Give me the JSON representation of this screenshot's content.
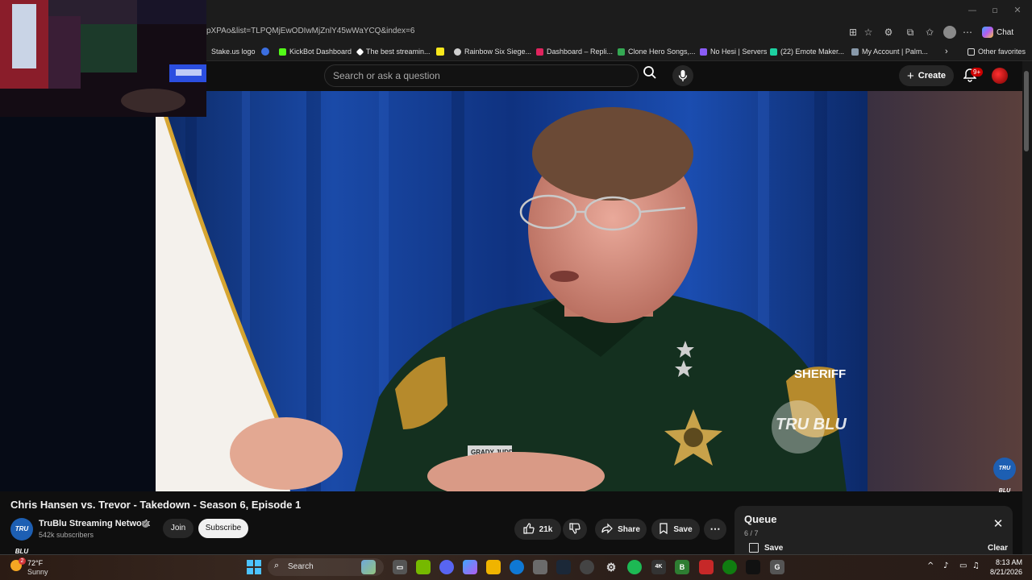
{
  "browser": {
    "url": "pXPAo&list=TLPQMjEwODIwMjZnlY45wWaYCQ&index=6",
    "copilot_label": "Chat",
    "bookmarks": [
      {
        "label": "Stake.us logo",
        "color": "#1a2c38"
      },
      {
        "label": "",
        "color": "#3b6ee0"
      },
      {
        "label": "KickBot Dashboard",
        "color": "#53fc18"
      },
      {
        "label": "The best streamin...",
        "color": "#ffffff"
      },
      {
        "label": "",
        "color": "#f8e71c"
      },
      {
        "label": "Rainbow Six Siege...",
        "color": "#cfcfcf"
      },
      {
        "label": "Dashboard – Repli...",
        "color": "#e0245e"
      },
      {
        "label": "Clone Hero Songs,...",
        "color": "#34a853"
      },
      {
        "label": "No Hesi | Servers",
        "color": "#8a5cf6"
      },
      {
        "label": "(22) Emote Maker...",
        "color": "#1dd1a1"
      },
      {
        "label": "My Account | Palm...",
        "color": "#8899aa"
      }
    ],
    "other_favorites": "Other favorites"
  },
  "youtube": {
    "search_placeholder": "Search or ask a question",
    "create_label": "Create",
    "notification_count": "9+"
  },
  "video": {
    "title": "Chris Hansen vs. Trevor - Takedown - Season 6, Episode 1",
    "watermark": "TRU BLU",
    "patch_text": "SHERIFF",
    "name_tag": "GRADY JUDD",
    "channel_name": "TruBlu Streaming Network",
    "channel_avatar_text": "TRU BLU",
    "subscribers": "542k subscribers",
    "join_label": "Join",
    "subscribe_label": "Subscribe",
    "like_count": "21k",
    "share_label": "Share",
    "save_label": "Save"
  },
  "queue": {
    "title": "Queue",
    "position": "6 / 7",
    "save_label": "Save",
    "clear_label": "Clear"
  },
  "taskbar": {
    "weather_temp": "72°F",
    "weather_desc": "Sunny",
    "weather_badge": "2",
    "search_label": "Search",
    "time": "8:13 AM",
    "date": "8/21/2026"
  }
}
